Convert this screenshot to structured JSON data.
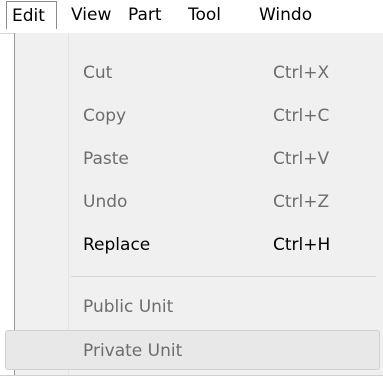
{
  "menubar": {
    "items": [
      {
        "label": "Edit"
      },
      {
        "label": "View"
      },
      {
        "label": "Part"
      },
      {
        "label": "Tool"
      },
      {
        "label": "Windo"
      }
    ]
  },
  "edit_menu": {
    "items": [
      {
        "label": "Cut",
        "shortcut": "Ctrl+X",
        "enabled": false
      },
      {
        "label": "Copy",
        "shortcut": "Ctrl+C",
        "enabled": false
      },
      {
        "label": "Paste",
        "shortcut": "Ctrl+V",
        "enabled": false
      },
      {
        "label": "Undo",
        "shortcut": "Ctrl+Z",
        "enabled": false
      },
      {
        "label": "Replace",
        "shortcut": "Ctrl+H",
        "enabled": true
      },
      {
        "label": "Public Unit",
        "enabled": false
      },
      {
        "label": "Private Unit",
        "enabled": false,
        "highlighted": true
      }
    ]
  }
}
